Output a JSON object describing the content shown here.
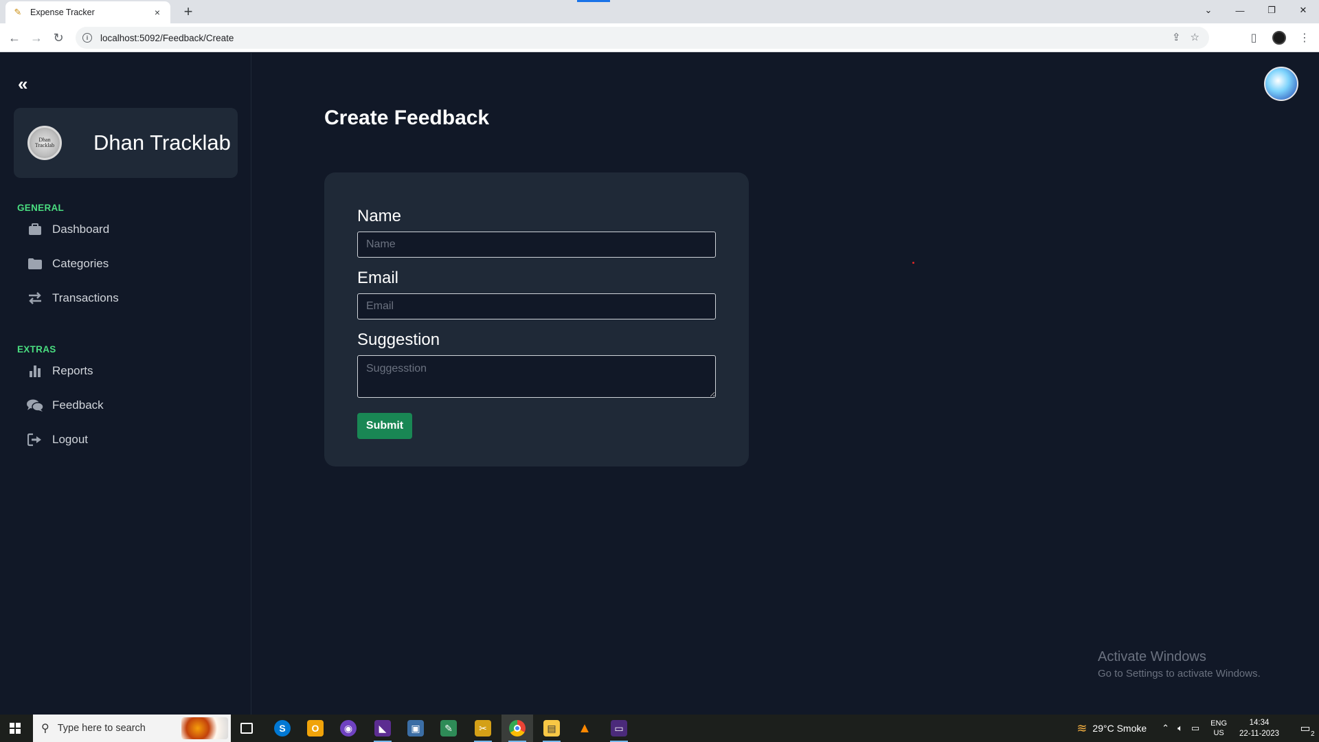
{
  "browser": {
    "tab_title": "Expense Tracker",
    "tab_close": "×",
    "new_tab": "+",
    "url": "localhost:5092/Feedback/Create"
  },
  "sidebar": {
    "brand_name": "Dhan Tracklab",
    "logo_text": "Dhan Tracklab",
    "sections": [
      {
        "label": "GENERAL",
        "items": [
          {
            "label": "Dashboard",
            "icon": "briefcase-icon"
          },
          {
            "label": "Categories",
            "icon": "folder-icon"
          },
          {
            "label": "Transactions",
            "icon": "arrows-exchange-icon"
          }
        ]
      },
      {
        "label": "EXTRAS",
        "items": [
          {
            "label": "Reports",
            "icon": "bar-chart-icon"
          },
          {
            "label": "Feedback",
            "icon": "comments-icon"
          },
          {
            "label": "Logout",
            "icon": "logout-icon"
          }
        ]
      }
    ]
  },
  "main": {
    "title": "Create Feedback",
    "form": {
      "name_label": "Name",
      "name_placeholder": "Name",
      "name_value": "",
      "email_label": "Email",
      "email_placeholder": "Email",
      "email_value": "",
      "suggestion_label": "Suggestion",
      "suggestion_placeholder": "Suggesstion",
      "suggestion_value": "",
      "submit_label": "Submit"
    }
  },
  "watermark": {
    "title": "Activate Windows",
    "subtitle": "Go to Settings to activate Windows."
  },
  "taskbar": {
    "search_placeholder": "Type here to search",
    "weather": "29°C  Smoke",
    "lang_top": "ENG",
    "lang_bottom": "US",
    "time": "14:34",
    "date": "22-11-2023",
    "notification_count": "2"
  },
  "colors": {
    "background": "#111827",
    "card": "#1f2937",
    "accent_green": "#4ade80",
    "submit": "#198754"
  }
}
